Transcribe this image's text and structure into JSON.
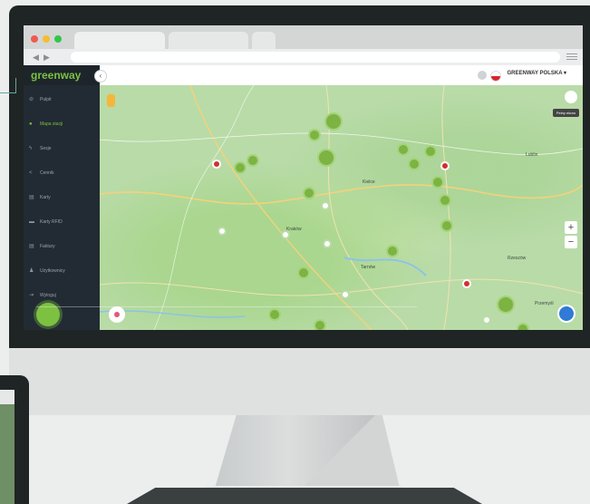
{
  "app": {
    "logo_text": "greenway",
    "company_selector": "GREENWAY POLSKA",
    "brand_color": "#7cc142",
    "sidebar_color": "#222b33"
  },
  "browser": {
    "back_icon": "◀",
    "forward_icon": "▶"
  },
  "sidebar": {
    "items": [
      {
        "label": "Pulpit",
        "icon": "dashboard-icon",
        "glyph": "⊘"
      },
      {
        "label": "Mapa stacji",
        "icon": "map-pin-icon",
        "glyph": "●",
        "active": true
      },
      {
        "label": "Sesje",
        "icon": "bolt-icon",
        "glyph": "ϟ"
      },
      {
        "label": "Cennik",
        "icon": "tag-icon",
        "glyph": "<"
      },
      {
        "label": "Karty",
        "icon": "card-icon",
        "glyph": "▤"
      },
      {
        "label": "Karty RFID",
        "icon": "rfid-icon",
        "glyph": "▬"
      },
      {
        "label": "Faktury",
        "icon": "invoice-icon",
        "glyph": "▤"
      },
      {
        "label": "Użytkownicy",
        "icon": "user-icon",
        "glyph": "♟"
      },
      {
        "label": "Wyloguj",
        "icon": "logout-icon",
        "glyph": "⇥"
      }
    ]
  },
  "map": {
    "zoom_in": "+",
    "zoom_out": "−",
    "tooltip": "Pełny ekran",
    "cities": [
      "Kraków",
      "Rzeszów",
      "Tarnów",
      "Kielce",
      "Lublin",
      "Przemyśl"
    ]
  }
}
